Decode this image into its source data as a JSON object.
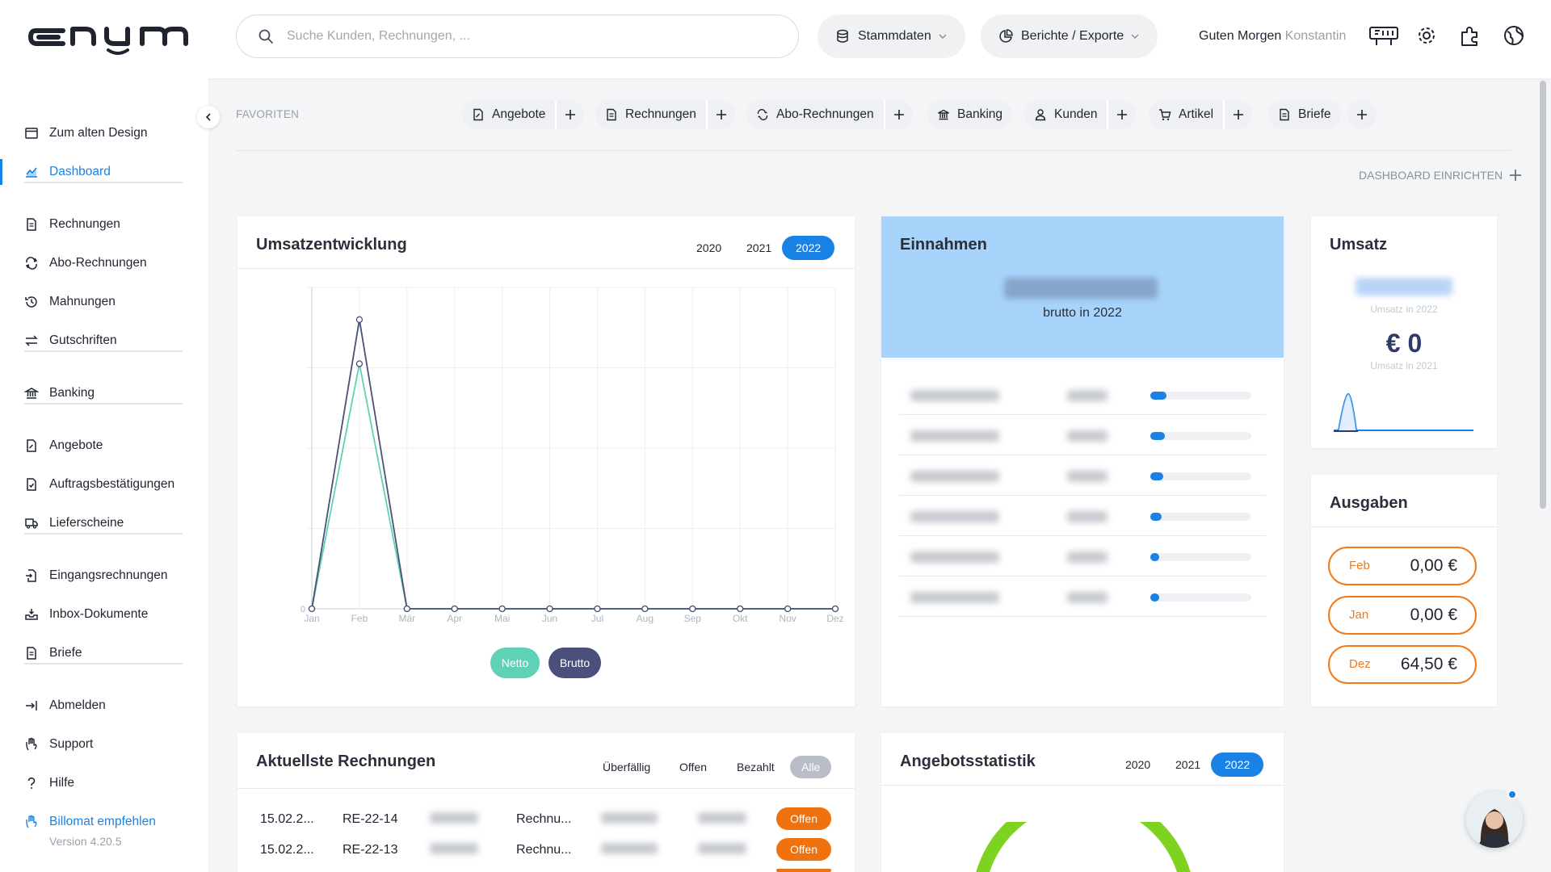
{
  "header": {
    "search_placeholder": "Suche Kunden, Rechnungen, ...",
    "stammdaten": "Stammdaten",
    "berichte": "Berichte / Exporte",
    "greeting": "Guten Morgen",
    "user_name": "Konstantin"
  },
  "sidebar": {
    "items": [
      {
        "label": "Zum alten Design"
      },
      {
        "label": "Dashboard"
      },
      {
        "label": "Rechnungen"
      },
      {
        "label": "Abo-Rechnungen"
      },
      {
        "label": "Mahnungen"
      },
      {
        "label": "Gutschriften"
      },
      {
        "label": "Banking"
      },
      {
        "label": "Angebote"
      },
      {
        "label": "Auftragsbestätigungen"
      },
      {
        "label": "Lieferscheine"
      },
      {
        "label": "Eingangsrechnungen"
      },
      {
        "label": "Inbox-Dokumente"
      },
      {
        "label": "Briefe"
      },
      {
        "label": "Abmelden"
      },
      {
        "label": "Support"
      },
      {
        "label": "Hilfe"
      },
      {
        "label": "Billomat empfehlen"
      }
    ],
    "version": "Version 4.20.5"
  },
  "favorites": {
    "label": "FAVORITEN",
    "items": [
      "Angebote",
      "Rechnungen",
      "Abo-Rechnungen",
      "Banking",
      "Kunden",
      "Artikel",
      "Briefe"
    ],
    "dashboard_setup": "DASHBOARD EINRICHTEN"
  },
  "umsatzentwicklung": {
    "title": "Umsatzentwicklung",
    "years": [
      "2020",
      "2021",
      "2022"
    ],
    "active_year": "2022",
    "legend": [
      "Netto",
      "Brutto"
    ]
  },
  "chart_data": {
    "type": "line",
    "categories": [
      "Jan",
      "Feb",
      "Mär",
      "Apr",
      "Mai",
      "Jun",
      "Jul",
      "Aug",
      "Sep",
      "Okt",
      "Nov",
      "Dez"
    ],
    "series": [
      {
        "name": "Netto",
        "values": [
          0,
          61,
          0,
          0,
          0,
          0,
          0,
          0,
          0,
          0,
          0,
          0
        ],
        "color": "#5fd1b4"
      },
      {
        "name": "Brutto",
        "values": [
          0,
          72,
          0,
          0,
          0,
          0,
          0,
          0,
          0,
          0,
          0,
          0
        ],
        "color": "#4a4f7c"
      }
    ],
    "ylim": [
      0,
      80
    ],
    "y_ticks": [
      "0"
    ],
    "grid": true
  },
  "einnahmen": {
    "title": "Einnahmen",
    "subtitle": "brutto in 2022",
    "rows": [
      {
        "fill": 0.16
      },
      {
        "fill": 0.14
      },
      {
        "fill": 0.13
      },
      {
        "fill": 0.11
      },
      {
        "fill": 0.09
      },
      {
        "fill": 0.09
      }
    ]
  },
  "umsatz": {
    "title": "Umsatz",
    "label_2022": "Umsatz in 2022",
    "value_2021": "€ 0",
    "label_2021": "Umsatz in 2021"
  },
  "ausgaben": {
    "title": "Ausgaben",
    "items": [
      {
        "month": "Feb",
        "value": "0,00 €"
      },
      {
        "month": "Jan",
        "value": "0,00 €"
      },
      {
        "month": "Dez",
        "value": "64,50 €"
      }
    ]
  },
  "rechnungen": {
    "title": "Aktuellste Rechnungen",
    "filters": [
      "Überfällig",
      "Offen",
      "Bezahlt",
      "Alle"
    ],
    "active_filter": "Alle",
    "rows": [
      {
        "date": "15.02.2...",
        "number": "RE-22-14",
        "type": "Rechnu...",
        "status": "Offen"
      },
      {
        "date": "15.02.2...",
        "number": "RE-22-13",
        "type": "Rechnu...",
        "status": "Offen"
      }
    ]
  },
  "angebotsstatistik": {
    "title": "Angebotsstatistik",
    "years": [
      "2020",
      "2021",
      "2022"
    ],
    "active_year": "2022"
  },
  "colors": {
    "accent": "#1a82e4",
    "netto": "#5fd1b4",
    "brutto": "#4a4f7c",
    "orange": "#f07a1a",
    "einnahmen_bg": "#a8d4fb",
    "gauge": "#7ed321"
  }
}
